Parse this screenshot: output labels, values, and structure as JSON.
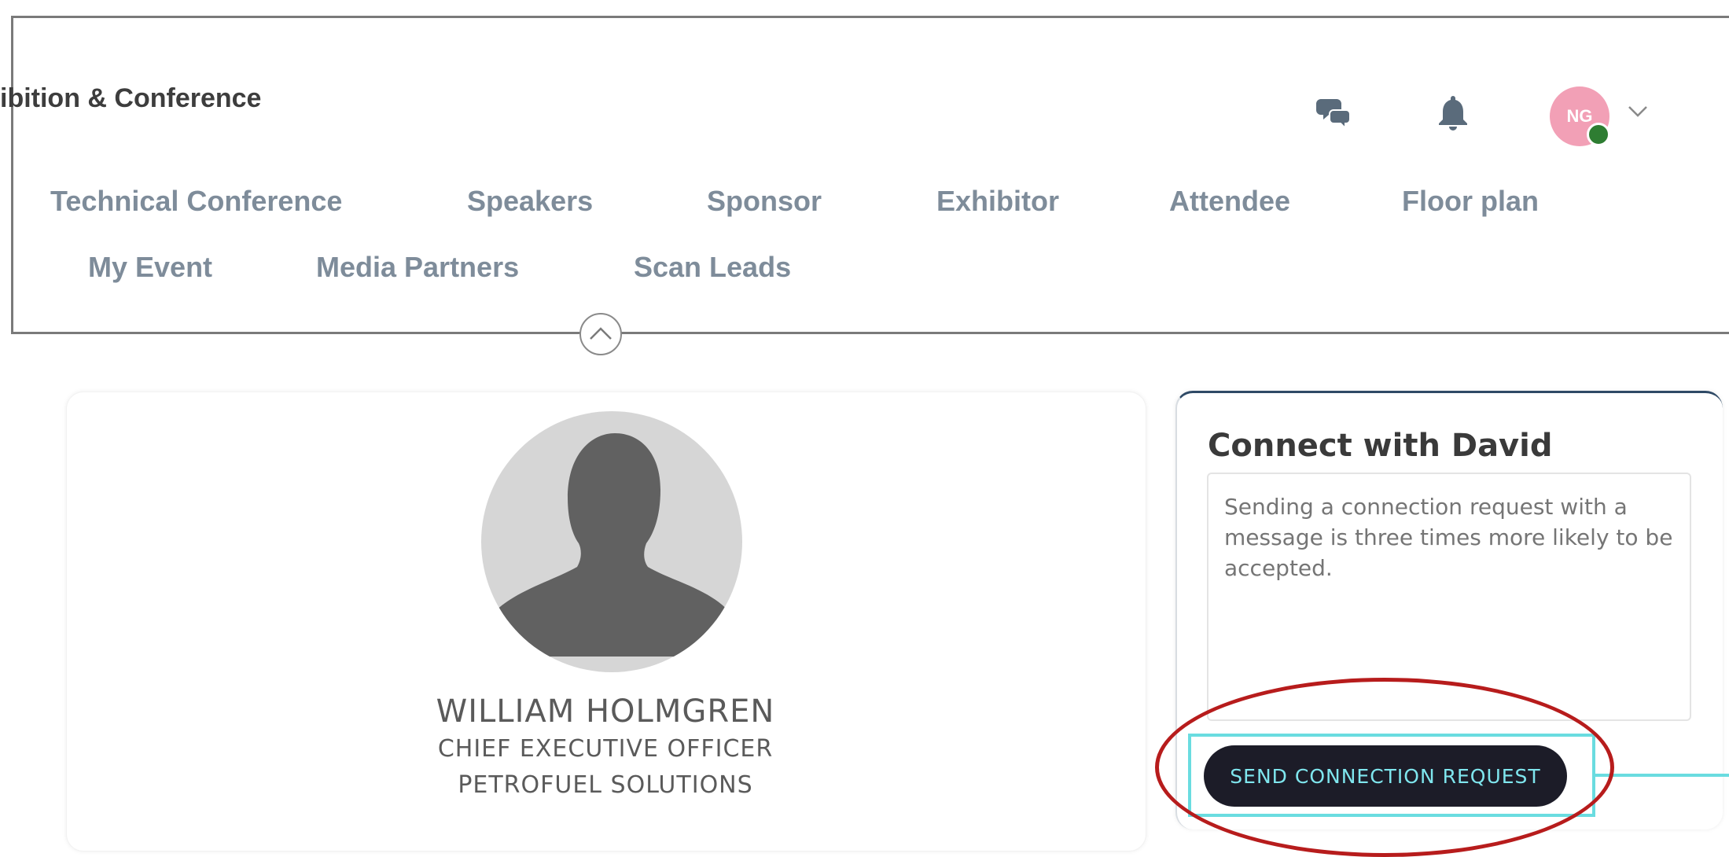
{
  "header": {
    "event_title": "ibition & Conference",
    "nav_row1": [
      "Technical Conference",
      "Speakers",
      "Sponsor",
      "Exhibitor",
      "Attendee",
      "Floor plan"
    ],
    "nav_row2": [
      "My Event",
      "Media Partners",
      "Scan Leads"
    ],
    "icons": {
      "chat": "chat-bubbles-icon",
      "notifications": "bell-icon",
      "menu": "chevron-down-icon",
      "collapse": "chevron-up-icon"
    },
    "user_initials": "NG",
    "presence_status": "online"
  },
  "profile": {
    "name": "WILLIAM HOLMGREN",
    "job_title": "CHIEF EXECUTIVE OFFICER",
    "company": "PETROFUEL SOLUTIONS",
    "avatar_icon": "person-silhouette-icon"
  },
  "connect": {
    "title": "Connect with David",
    "message_placeholder": "Sending a connection request with a message is three times more likely to be accepted.",
    "send_label": "SEND CONNECTION REQUEST"
  },
  "colors": {
    "nav_text": "#7e8c9a",
    "avatar_bg": "#f2a0b6",
    "presence": "#2e7d32",
    "button_bg": "#1c1c28",
    "button_text": "#7fe6ee",
    "annotation_highlight": "#6adce0",
    "annotation_circle": "#b71c1c"
  }
}
